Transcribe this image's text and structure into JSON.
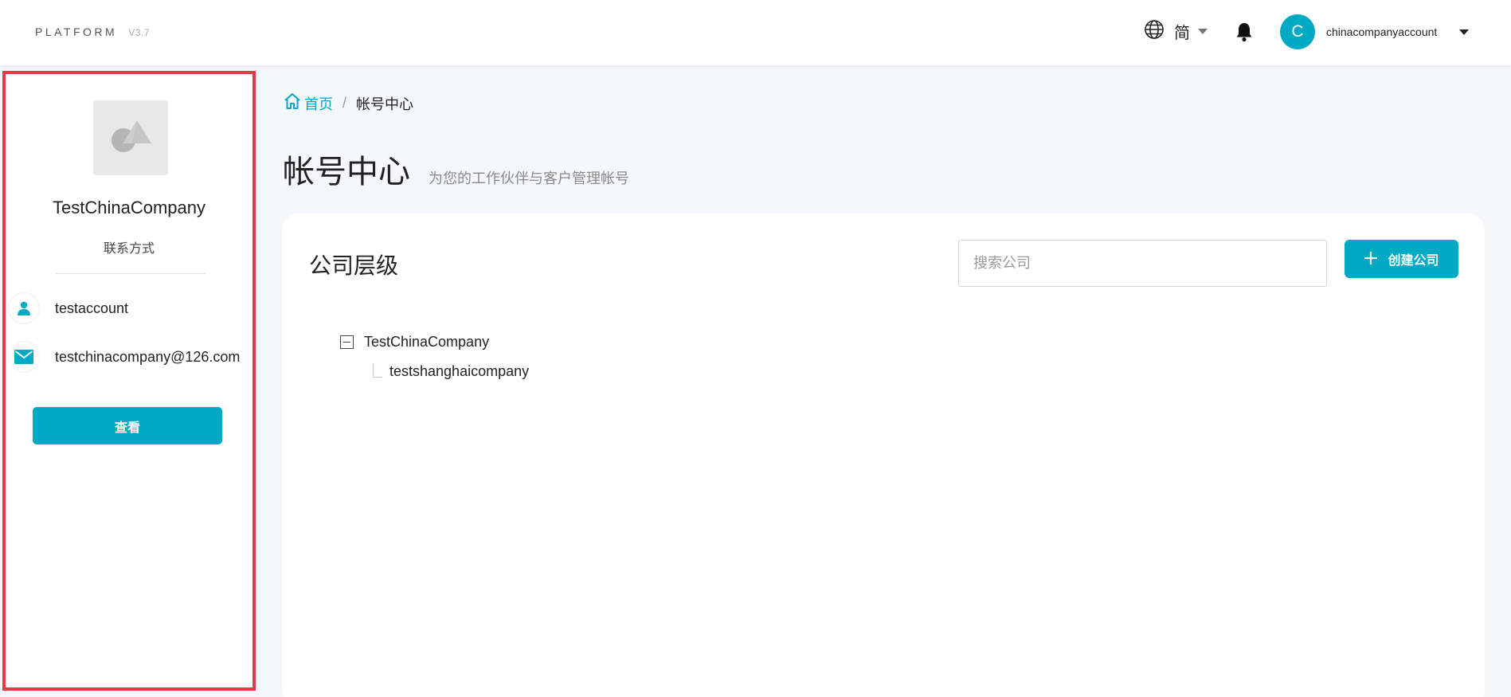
{
  "header": {
    "brand_name": "PLATFORM",
    "brand_version": "V3.7",
    "language": "简",
    "user_initial": "C",
    "user_name": "chinacompanyaccount"
  },
  "sidebar": {
    "company_name": "TestChinaCompany",
    "contact_label": "联系方式",
    "account": "testaccount",
    "email": "testchinacompany@126.com",
    "view_button": "查看"
  },
  "breadcrumb": {
    "home": "首页",
    "separator": "/",
    "current": "帐号中心"
  },
  "page": {
    "title": "帐号中心",
    "subtitle": "为您的工作伙伴与客户管理帐号"
  },
  "card": {
    "title": "公司层级",
    "search_placeholder": "搜索公司",
    "create_button": "创建公司"
  },
  "tree": {
    "root": "TestChinaCompany",
    "children": [
      "testshanghaicompany"
    ]
  },
  "colors": {
    "accent": "#00a9c4",
    "highlight_border": "#e53945"
  },
  "icons": [
    "globe-icon",
    "bell-icon",
    "shapes-icon",
    "user-icon",
    "mail-icon",
    "home-icon",
    "plus-icon",
    "collapse-icon"
  ]
}
